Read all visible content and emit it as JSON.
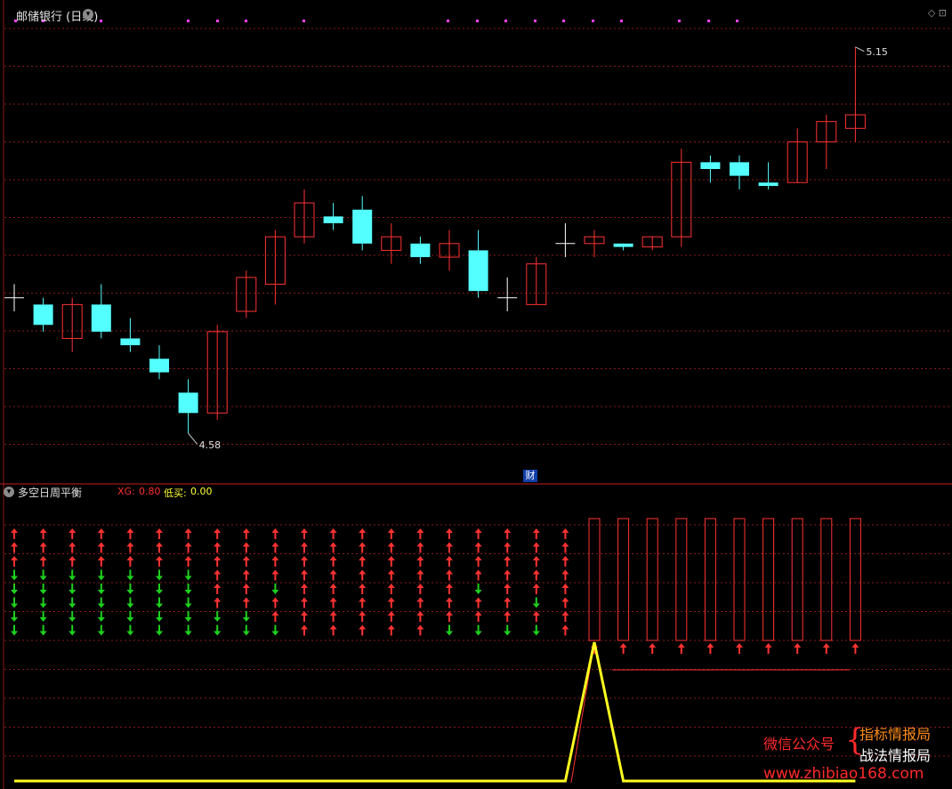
{
  "header": {
    "title": "邮储银行 (日线)"
  },
  "price_labels": {
    "high": "5.15",
    "low": "4.58"
  },
  "finance_badge": "财",
  "indicator": {
    "name": "多空日周平衡",
    "xg_label": "XG:",
    "xg_value": "0.80",
    "buy_label": "低买:",
    "buy_value": "0.00"
  },
  "watermark": {
    "wechat": "微信公众号",
    "brace": "{",
    "line1": "指标情报局",
    "line2": "战法情报局",
    "url": "www.zhibiao168.com"
  },
  "colors": {
    "up": "#ff3232",
    "down": "#54ffff",
    "neutral": "#ffffff",
    "green_arrow": "#1ed01e",
    "yellow_line": "#ffff20",
    "grid": "#8a1a1a"
  },
  "chart_data": {
    "type": "candlestick",
    "title": "邮储银行 (日线)",
    "ylim": [
      4.55,
      5.18
    ],
    "candles": [
      {
        "o": 4.78,
        "h": 4.8,
        "l": 4.76,
        "c": 4.78,
        "kind": "doji"
      },
      {
        "o": 4.77,
        "h": 4.78,
        "l": 4.73,
        "c": 4.74,
        "kind": "down"
      },
      {
        "o": 4.72,
        "h": 4.78,
        "l": 4.7,
        "c": 4.77,
        "kind": "up"
      },
      {
        "o": 4.77,
        "h": 4.8,
        "l": 4.72,
        "c": 4.73,
        "kind": "down"
      },
      {
        "o": 4.72,
        "h": 4.75,
        "l": 4.7,
        "c": 4.71,
        "kind": "down"
      },
      {
        "o": 4.69,
        "h": 4.71,
        "l": 4.66,
        "c": 4.67,
        "kind": "down"
      },
      {
        "o": 4.64,
        "h": 4.66,
        "l": 4.58,
        "c": 4.61,
        "kind": "down"
      },
      {
        "o": 4.61,
        "h": 4.74,
        "l": 4.6,
        "c": 4.73,
        "kind": "up"
      },
      {
        "o": 4.76,
        "h": 4.82,
        "l": 4.75,
        "c": 4.81,
        "kind": "up"
      },
      {
        "o": 4.8,
        "h": 4.88,
        "l": 4.77,
        "c": 4.87,
        "kind": "up"
      },
      {
        "o": 4.87,
        "h": 4.94,
        "l": 4.86,
        "c": 4.92,
        "kind": "up"
      },
      {
        "o": 4.9,
        "h": 4.92,
        "l": 4.88,
        "c": 4.89,
        "kind": "down"
      },
      {
        "o": 4.91,
        "h": 4.93,
        "l": 4.85,
        "c": 4.86,
        "kind": "down"
      },
      {
        "o": 4.85,
        "h": 4.89,
        "l": 4.83,
        "c": 4.87,
        "kind": "up"
      },
      {
        "o": 4.86,
        "h": 4.87,
        "l": 4.83,
        "c": 4.84,
        "kind": "down"
      },
      {
        "o": 4.84,
        "h": 4.88,
        "l": 4.82,
        "c": 4.86,
        "kind": "up"
      },
      {
        "o": 4.85,
        "h": 4.88,
        "l": 4.78,
        "c": 4.79,
        "kind": "down"
      },
      {
        "o": 4.78,
        "h": 4.81,
        "l": 4.76,
        "c": 4.78,
        "kind": "doji"
      },
      {
        "o": 4.77,
        "h": 4.84,
        "l": 4.77,
        "c": 4.83,
        "kind": "up"
      },
      {
        "o": 4.86,
        "h": 4.89,
        "l": 4.84,
        "c": 4.86,
        "kind": "doji"
      },
      {
        "o": 4.86,
        "h": 4.88,
        "l": 4.84,
        "c": 4.87,
        "kind": "up"
      },
      {
        "o": 4.86,
        "h": 4.86,
        "l": 4.85,
        "c": 4.855,
        "kind": "down"
      },
      {
        "o": 4.855,
        "h": 4.87,
        "l": 4.85,
        "c": 4.87,
        "kind": "up"
      },
      {
        "o": 4.87,
        "h": 5.0,
        "l": 4.855,
        "c": 4.98,
        "kind": "up"
      },
      {
        "o": 4.98,
        "h": 4.99,
        "l": 4.95,
        "c": 4.97,
        "kind": "down"
      },
      {
        "o": 4.98,
        "h": 4.99,
        "l": 4.94,
        "c": 4.96,
        "kind": "down"
      },
      {
        "o": 4.95,
        "h": 4.98,
        "l": 4.94,
        "c": 4.945,
        "kind": "down"
      },
      {
        "o": 4.95,
        "h": 5.03,
        "l": 4.95,
        "c": 5.01,
        "kind": "up"
      },
      {
        "o": 5.01,
        "h": 5.05,
        "l": 4.97,
        "c": 5.04,
        "kind": "up"
      },
      {
        "o": 5.03,
        "h": 5.15,
        "l": 5.01,
        "c": 5.05,
        "kind": "up"
      }
    ],
    "indicator_arrows": [
      "uuuddddd",
      "uuuddddd",
      "uuuddddd",
      "uuuddddd",
      "uuuddddd",
      "uuuddddd",
      "uuuddddd",
      "uuuuuudd",
      "uuuuuudd",
      "uuuuduud",
      "uuuuuuuu",
      "uuuuuuuu",
      "uuuuuuuu",
      "uuuuuuuu",
      "uuuuuuuu",
      "uuuuuuud",
      "uuuuduud",
      "uuuuuuud",
      "uuuuudud",
      "uuuuuuuu"
    ],
    "signal_bars": 10,
    "yellow_line": [
      0,
      0,
      0,
      0,
      0,
      0,
      0,
      0,
      0,
      0,
      0,
      0,
      0,
      0,
      0,
      0,
      0,
      0,
      0,
      0,
      1,
      0,
      0,
      0,
      0,
      0,
      0,
      0,
      0,
      0
    ]
  }
}
